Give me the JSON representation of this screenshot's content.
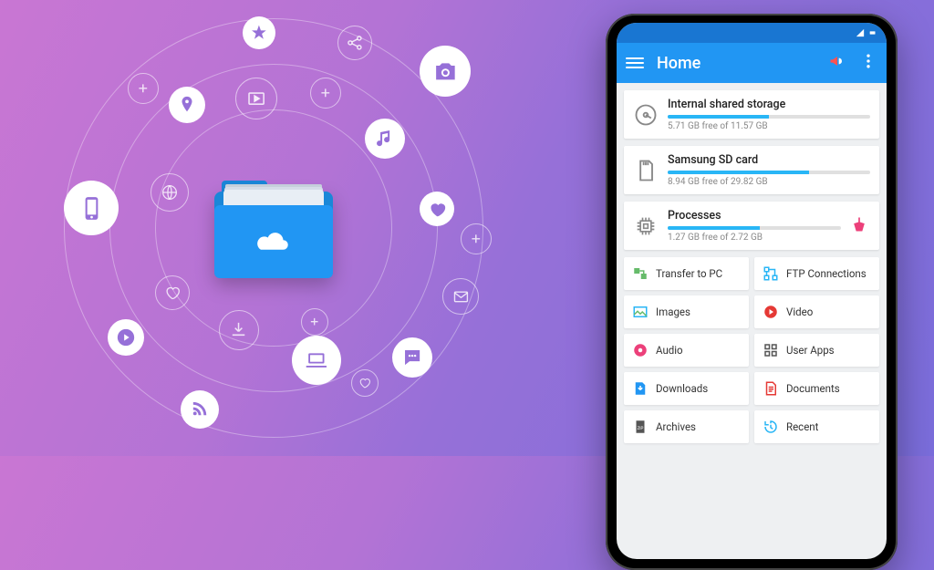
{
  "app": {
    "title": "Home"
  },
  "storage": [
    {
      "icon": "hdd",
      "title": "Internal shared storage",
      "sub": "5.71 GB free of 11.57 GB",
      "pct": 50
    },
    {
      "icon": "sd",
      "title": "Samsung SD card",
      "sub": "8.94 GB free of 29.82 GB",
      "pct": 70
    },
    {
      "icon": "cpu",
      "title": "Processes",
      "sub": "1.27 GB free of 2.72 GB",
      "pct": 53,
      "action": "clean"
    }
  ],
  "tiles": [
    {
      "icon": "transfer",
      "label": "Transfer to PC",
      "color": "#66bb6a"
    },
    {
      "icon": "ftp",
      "label": "FTP Connections",
      "color": "#29b6f6"
    },
    {
      "icon": "images",
      "label": "Images",
      "color": "#29b6f6"
    },
    {
      "icon": "video",
      "label": "Video",
      "color": "#e53935"
    },
    {
      "icon": "audio",
      "label": "Audio",
      "color": "#ec407a"
    },
    {
      "icon": "apps",
      "label": "User Apps",
      "color": "#555"
    },
    {
      "icon": "downloads",
      "label": "Downloads",
      "color": "#2196f3"
    },
    {
      "icon": "docs",
      "label": "Documents",
      "color": "#e53935"
    },
    {
      "icon": "archives",
      "label": "Archives",
      "color": "#555"
    },
    {
      "icon": "recent",
      "label": "Recent",
      "color": "#29b6f6"
    }
  ],
  "bubbles": {
    "center": "cloud-folder",
    "items": [
      "star",
      "share",
      "camera",
      "plus",
      "pin",
      "video",
      "music",
      "phone",
      "globe",
      "heart",
      "plus",
      "heart",
      "play",
      "download",
      "laptop",
      "heart",
      "rss",
      "mail",
      "chat",
      "plus",
      "plus"
    ]
  }
}
